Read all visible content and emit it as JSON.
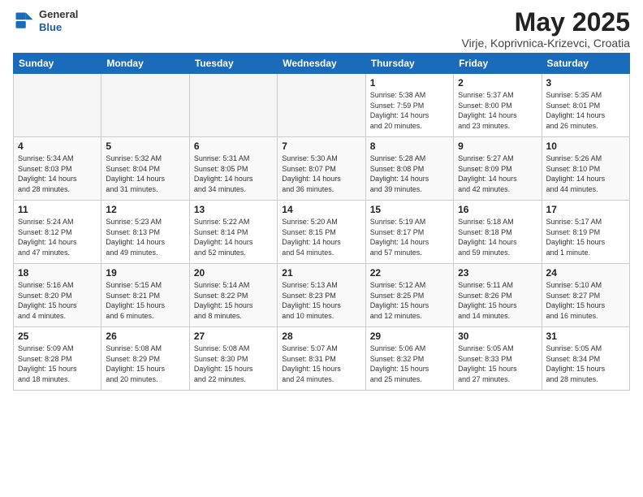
{
  "header": {
    "logo_general": "General",
    "logo_blue": "Blue",
    "month_title": "May 2025",
    "location": "Virje, Koprivnica-Krizevci, Croatia"
  },
  "weekdays": [
    "Sunday",
    "Monday",
    "Tuesday",
    "Wednesday",
    "Thursday",
    "Friday",
    "Saturday"
  ],
  "weeks": [
    [
      {
        "day": "",
        "info": ""
      },
      {
        "day": "",
        "info": ""
      },
      {
        "day": "",
        "info": ""
      },
      {
        "day": "",
        "info": ""
      },
      {
        "day": "1",
        "info": "Sunrise: 5:38 AM\nSunset: 7:59 PM\nDaylight: 14 hours\nand 20 minutes."
      },
      {
        "day": "2",
        "info": "Sunrise: 5:37 AM\nSunset: 8:00 PM\nDaylight: 14 hours\nand 23 minutes."
      },
      {
        "day": "3",
        "info": "Sunrise: 5:35 AM\nSunset: 8:01 PM\nDaylight: 14 hours\nand 26 minutes."
      }
    ],
    [
      {
        "day": "4",
        "info": "Sunrise: 5:34 AM\nSunset: 8:03 PM\nDaylight: 14 hours\nand 28 minutes."
      },
      {
        "day": "5",
        "info": "Sunrise: 5:32 AM\nSunset: 8:04 PM\nDaylight: 14 hours\nand 31 minutes."
      },
      {
        "day": "6",
        "info": "Sunrise: 5:31 AM\nSunset: 8:05 PM\nDaylight: 14 hours\nand 34 minutes."
      },
      {
        "day": "7",
        "info": "Sunrise: 5:30 AM\nSunset: 8:07 PM\nDaylight: 14 hours\nand 36 minutes."
      },
      {
        "day": "8",
        "info": "Sunrise: 5:28 AM\nSunset: 8:08 PM\nDaylight: 14 hours\nand 39 minutes."
      },
      {
        "day": "9",
        "info": "Sunrise: 5:27 AM\nSunset: 8:09 PM\nDaylight: 14 hours\nand 42 minutes."
      },
      {
        "day": "10",
        "info": "Sunrise: 5:26 AM\nSunset: 8:10 PM\nDaylight: 14 hours\nand 44 minutes."
      }
    ],
    [
      {
        "day": "11",
        "info": "Sunrise: 5:24 AM\nSunset: 8:12 PM\nDaylight: 14 hours\nand 47 minutes."
      },
      {
        "day": "12",
        "info": "Sunrise: 5:23 AM\nSunset: 8:13 PM\nDaylight: 14 hours\nand 49 minutes."
      },
      {
        "day": "13",
        "info": "Sunrise: 5:22 AM\nSunset: 8:14 PM\nDaylight: 14 hours\nand 52 minutes."
      },
      {
        "day": "14",
        "info": "Sunrise: 5:20 AM\nSunset: 8:15 PM\nDaylight: 14 hours\nand 54 minutes."
      },
      {
        "day": "15",
        "info": "Sunrise: 5:19 AM\nSunset: 8:17 PM\nDaylight: 14 hours\nand 57 minutes."
      },
      {
        "day": "16",
        "info": "Sunrise: 5:18 AM\nSunset: 8:18 PM\nDaylight: 14 hours\nand 59 minutes."
      },
      {
        "day": "17",
        "info": "Sunrise: 5:17 AM\nSunset: 8:19 PM\nDaylight: 15 hours\nand 1 minute."
      }
    ],
    [
      {
        "day": "18",
        "info": "Sunrise: 5:16 AM\nSunset: 8:20 PM\nDaylight: 15 hours\nand 4 minutes."
      },
      {
        "day": "19",
        "info": "Sunrise: 5:15 AM\nSunset: 8:21 PM\nDaylight: 15 hours\nand 6 minutes."
      },
      {
        "day": "20",
        "info": "Sunrise: 5:14 AM\nSunset: 8:22 PM\nDaylight: 15 hours\nand 8 minutes."
      },
      {
        "day": "21",
        "info": "Sunrise: 5:13 AM\nSunset: 8:23 PM\nDaylight: 15 hours\nand 10 minutes."
      },
      {
        "day": "22",
        "info": "Sunrise: 5:12 AM\nSunset: 8:25 PM\nDaylight: 15 hours\nand 12 minutes."
      },
      {
        "day": "23",
        "info": "Sunrise: 5:11 AM\nSunset: 8:26 PM\nDaylight: 15 hours\nand 14 minutes."
      },
      {
        "day": "24",
        "info": "Sunrise: 5:10 AM\nSunset: 8:27 PM\nDaylight: 15 hours\nand 16 minutes."
      }
    ],
    [
      {
        "day": "25",
        "info": "Sunrise: 5:09 AM\nSunset: 8:28 PM\nDaylight: 15 hours\nand 18 minutes."
      },
      {
        "day": "26",
        "info": "Sunrise: 5:08 AM\nSunset: 8:29 PM\nDaylight: 15 hours\nand 20 minutes."
      },
      {
        "day": "27",
        "info": "Sunrise: 5:08 AM\nSunset: 8:30 PM\nDaylight: 15 hours\nand 22 minutes."
      },
      {
        "day": "28",
        "info": "Sunrise: 5:07 AM\nSunset: 8:31 PM\nDaylight: 15 hours\nand 24 minutes."
      },
      {
        "day": "29",
        "info": "Sunrise: 5:06 AM\nSunset: 8:32 PM\nDaylight: 15 hours\nand 25 minutes."
      },
      {
        "day": "30",
        "info": "Sunrise: 5:05 AM\nSunset: 8:33 PM\nDaylight: 15 hours\nand 27 minutes."
      },
      {
        "day": "31",
        "info": "Sunrise: 5:05 AM\nSunset: 8:34 PM\nDaylight: 15 hours\nand 28 minutes."
      }
    ]
  ]
}
